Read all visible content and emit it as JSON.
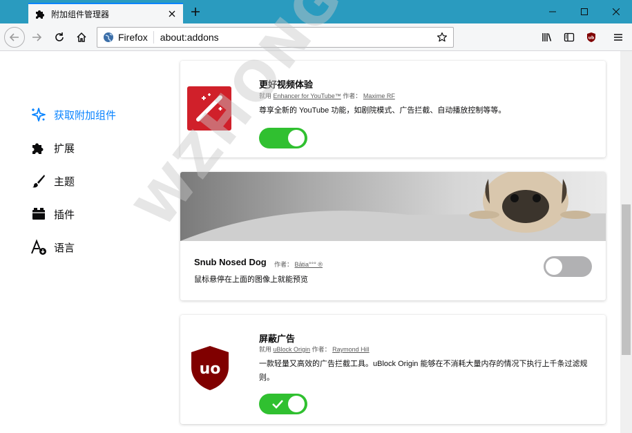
{
  "tab": {
    "title": "附加组件管理器"
  },
  "address": {
    "identity": "Firefox",
    "url": "about:addons"
  },
  "sidebar": {
    "items": [
      {
        "label": "获取附加组件"
      },
      {
        "label": "扩展"
      },
      {
        "label": "主题"
      },
      {
        "label": "插件"
      },
      {
        "label": "语言"
      }
    ]
  },
  "addons": [
    {
      "name": "更好视频体验",
      "by_prefix": "就用",
      "source": "Enhancer for YouTube™",
      "author_prefix": "作者：",
      "author": "Maxime RF",
      "description": "尊享全新的 YouTube 功能，如剧院模式、广告拦截、自动播放控制等等。",
      "enabled": true
    },
    {
      "name": "Snub Nosed Dog",
      "author_prefix": "作者：",
      "author": "Bātia°°° ®",
      "description": "鼠标悬停在上面的图像上就能预览",
      "enabled": false
    },
    {
      "name": "屏蔽广告",
      "by_prefix": "就用",
      "source": "uBlock Origin",
      "author_prefix": "作者：",
      "author": "Raymond Hill",
      "description": "一款轻量又高效的广告拦截工具。uBlock Origin 能够在不消耗大量内存的情况下执行上千条过滤规则。",
      "logo_text": "uo",
      "enabled": true
    }
  ],
  "watermark": "WZHONGHE.COM",
  "colors": {
    "accent": "#0a84ff",
    "toggle_on": "#30c030",
    "titlebar": "#2a9bbf"
  }
}
